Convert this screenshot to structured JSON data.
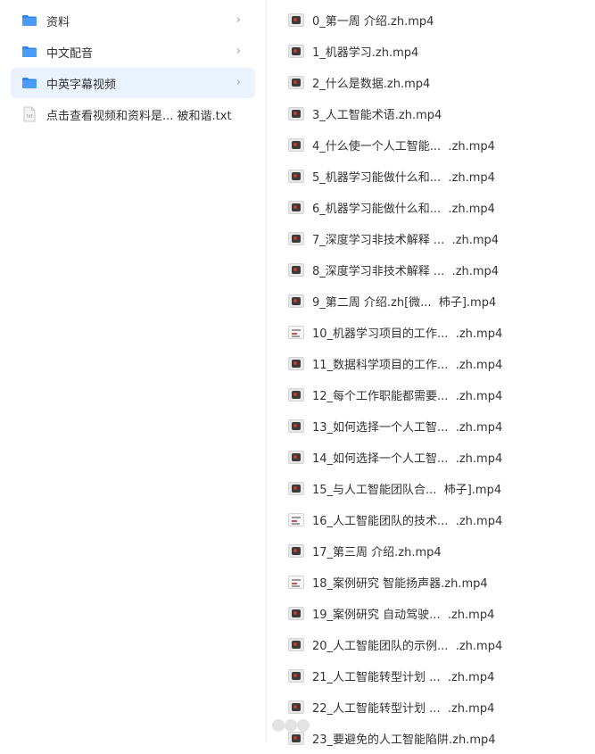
{
  "left_pane": {
    "items": [
      {
        "label": "资料",
        "type": "folder",
        "selected": false,
        "has_chevron": true
      },
      {
        "label": "中文配音",
        "type": "folder",
        "selected": false,
        "has_chevron": true
      },
      {
        "label": "中英字幕视频",
        "type": "folder",
        "selected": true,
        "has_chevron": true
      },
      {
        "label": "点击查看视频和资料是... 被和谐.txt",
        "type": "txt",
        "selected": false,
        "has_chevron": false
      }
    ],
    "chevron_glyph": "›",
    "txt_icon_label": "TXT"
  },
  "right_pane": {
    "files": [
      {
        "name": "0_第一周 介绍.zh.mp4",
        "thumb": "dark"
      },
      {
        "name": "1_机器学习.zh.mp4",
        "thumb": "dark"
      },
      {
        "name": "2_什么是数据.zh.mp4",
        "thumb": "dark"
      },
      {
        "name": "3_人工智能术语.zh.mp4",
        "thumb": "dark"
      },
      {
        "name": "4_什么使一个人工智能...  .zh.mp4",
        "thumb": "dark"
      },
      {
        "name": "5_机器学习能做什么和...  .zh.mp4",
        "thumb": "dark"
      },
      {
        "name": "6_机器学习能做什么和...  .zh.mp4",
        "thumb": "dark"
      },
      {
        "name": "7_深度学习非技术解释 ...  .zh.mp4",
        "thumb": "dark"
      },
      {
        "name": "8_深度学习非技术解释 ...  .zh.mp4",
        "thumb": "dark"
      },
      {
        "name": "9_第二周 介绍.zh[微...  柿子].mp4",
        "thumb": "dark"
      },
      {
        "name": "10_机器学习项目的工作...  .zh.mp4",
        "thumb": "doc"
      },
      {
        "name": "11_数据科学项目的工作...  .zh.mp4",
        "thumb": "dark"
      },
      {
        "name": "12_每个工作职能都需要...  .zh.mp4",
        "thumb": "dark"
      },
      {
        "name": "13_如何选择一个人工智...  .zh.mp4",
        "thumb": "dark"
      },
      {
        "name": "14_如何选择一个人工智...  .zh.mp4",
        "thumb": "dark"
      },
      {
        "name": "15_与人工智能团队合...  柿子].mp4",
        "thumb": "dark"
      },
      {
        "name": "16_人工智能团队的技术...  .zh.mp4",
        "thumb": "doc"
      },
      {
        "name": "17_第三周 介绍.zh.mp4",
        "thumb": "dark"
      },
      {
        "name": "18_案例研究 智能扬声器.zh.mp4",
        "thumb": "doc"
      },
      {
        "name": "19_案例研究 自动驾驶...  .zh.mp4",
        "thumb": "dark"
      },
      {
        "name": "20_人工智能团队的示例...  .zh.mp4",
        "thumb": "dark"
      },
      {
        "name": "21_人工智能转型计划 ...  .zh.mp4",
        "thumb": "dark"
      },
      {
        "name": "22_人工智能转型计划 ...  .zh.mp4",
        "thumb": "dark"
      },
      {
        "name": "23_要避免的人工智能陷阱.zh.mp4",
        "thumb": "dark"
      }
    ]
  },
  "colors": {
    "selected_bg": "#eaf2ff",
    "folder_blue": "#4c9cf5",
    "folder_blue_dark": "#2f86ee"
  }
}
